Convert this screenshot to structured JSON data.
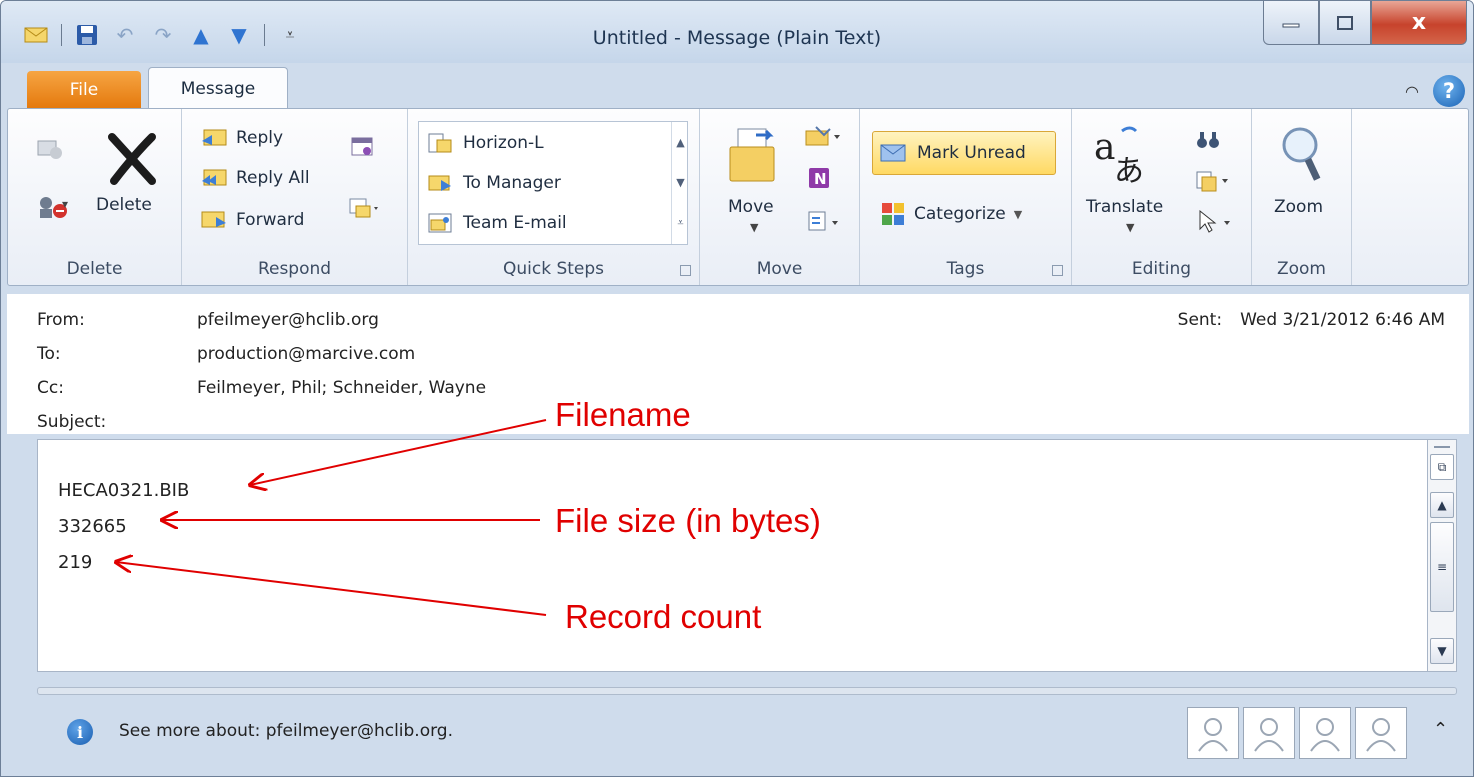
{
  "window": {
    "title": "Untitled  -  Message (Plain Text)",
    "close_glyph": "x",
    "qat_icons": [
      "mail-icon",
      "save-icon",
      "undo-icon",
      "redo-icon",
      "up-arrow-icon",
      "down-arrow-icon",
      "customize-qat-icon"
    ]
  },
  "tabs": {
    "file": "File",
    "message": "Message"
  },
  "ribbon": {
    "groups": {
      "delete": "Delete",
      "respond": "Respond",
      "quick_steps": "Quick Steps",
      "move": "Move",
      "tags": "Tags",
      "editing": "Editing",
      "zoom": "Zoom"
    },
    "delete_button": "Delete",
    "reply": "Reply",
    "reply_all": "Reply All",
    "forward": "Forward",
    "quick_steps": [
      "Horizon-L",
      "To Manager",
      "Team E-mail"
    ],
    "move_button": "Move",
    "mark_unread": "Mark Unread",
    "categorize": "Categorize",
    "translate": "Translate",
    "zoom_button": "Zoom"
  },
  "header": {
    "from_label": "From:",
    "from_value": "pfeilmeyer@hclib.org",
    "to_label": "To:",
    "to_value": "production@marcive.com",
    "cc_label": "Cc:",
    "cc_value": "Feilmeyer, Phil; Schneider, Wayne",
    "subject_label": "Subject:",
    "sent_label": "Sent:",
    "sent_value": "Wed 3/21/2012 6:46 AM"
  },
  "body": {
    "lines": [
      "HECA0321.BIB",
      "332665",
      "219"
    ]
  },
  "annotations": {
    "filename": "Filename",
    "file_size": "File size (in bytes)",
    "record_count": "Record count",
    "color": "#e00000"
  },
  "people_pane": {
    "see_more": "See more about: pfeilmeyer@hclib.org."
  }
}
